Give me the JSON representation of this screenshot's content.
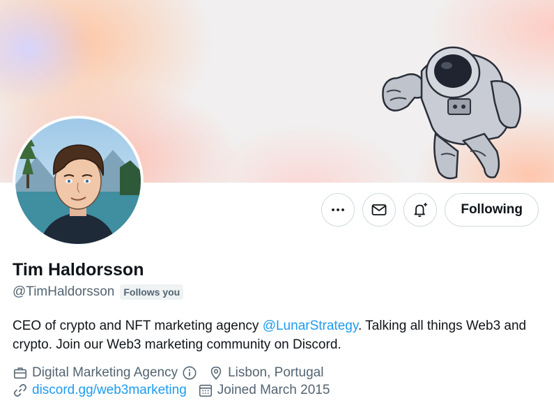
{
  "profile": {
    "display_name": "Tim Haldorsson",
    "handle": "@TimHaldorsson",
    "follows_you_badge": "Follows you",
    "bio": {
      "before_mention": "CEO of crypto and NFT marketing agency ",
      "mention": "@LunarStrategy",
      "after_mention": ". Talking all things Web3 and crypto. Join our Web3 marketing community on Discord."
    },
    "category": "Digital Marketing Agency",
    "location": "Lisbon, Portugal",
    "website": "discord.gg/web3marketing",
    "joined": "Joined March 2015"
  },
  "actions": {
    "more_icon": "more-horizontal-icon",
    "message_icon": "envelope-icon",
    "notify_icon": "bell-plus-icon",
    "following_label": "Following"
  },
  "icons": {
    "category": "briefcase-icon",
    "category_info": "info-circle-icon",
    "location": "location-pin-icon",
    "website": "link-icon",
    "joined": "calendar-icon"
  },
  "colors": {
    "link": "#1d9bf0",
    "secondary_text": "#536471",
    "primary_text": "#0f1419",
    "border": "#cfd9de"
  }
}
